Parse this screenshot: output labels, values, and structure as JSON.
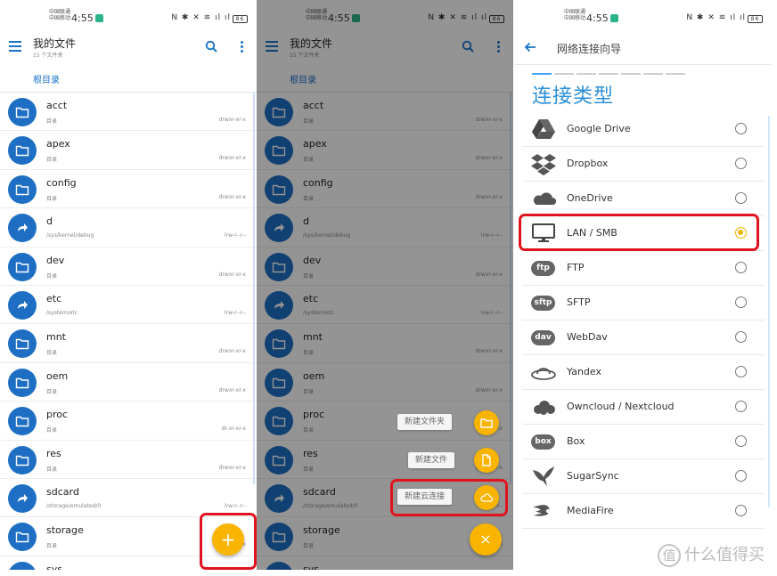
{
  "status_bar": {
    "carrier_1": "中国联通",
    "carrier_2": "中国移动",
    "time": "4:55",
    "icons": "N ✱ ✕ ≋ ıl ıl",
    "battery": "86"
  },
  "file_browser": {
    "title": "我的文件",
    "subtitle": "15 个文件夹",
    "breadcrumb": "根目录",
    "files": [
      {
        "name": "acct",
        "sub": "目录",
        "perm": "drwxr-xr-x",
        "type": "folder"
      },
      {
        "name": "apex",
        "sub": "目录",
        "perm": "drwxr-xr-x",
        "type": "folder"
      },
      {
        "name": "config",
        "sub": "目录",
        "perm": "drwxr-xr-x",
        "type": "folder"
      },
      {
        "name": "d",
        "sub": "/sys/kernel/debug",
        "perm": "lrw-r--r--",
        "type": "link"
      },
      {
        "name": "dev",
        "sub": "目录",
        "perm": "drwxr-xr-x",
        "type": "folder"
      },
      {
        "name": "etc",
        "sub": "/system/etc",
        "perm": "lrw-r--r--",
        "type": "link"
      },
      {
        "name": "mnt",
        "sub": "目录",
        "perm": "drwxr-xr-x",
        "type": "folder"
      },
      {
        "name": "oem",
        "sub": "目录",
        "perm": "drwxr-xr-x",
        "type": "folder"
      },
      {
        "name": "proc",
        "sub": "目录",
        "perm": "dr-xr-xr-x",
        "type": "folder"
      },
      {
        "name": "res",
        "sub": "目录",
        "perm": "drwxr-xr-x",
        "type": "folder"
      },
      {
        "name": "sdcard",
        "sub": "/storage/emulated/0",
        "perm": "lrw-r--r--",
        "type": "link"
      },
      {
        "name": "storage",
        "sub": "目录",
        "perm": "drwxr-xr-x",
        "type": "folder"
      },
      {
        "name": "sys",
        "sub": "",
        "perm": "",
        "type": "folder"
      }
    ],
    "fab_label": "+"
  },
  "fab_menu": {
    "new_folder": "新建文件夹",
    "new_file": "新建文件",
    "new_cloud": "新建云连接",
    "close_label": "×"
  },
  "wizard": {
    "title": "网络连接向导",
    "section_title": "连接类型",
    "selected": "LAN / SMB",
    "options": [
      {
        "label": "Google Drive",
        "icon": "google-drive-icon"
      },
      {
        "label": "Dropbox",
        "icon": "dropbox-icon"
      },
      {
        "label": "OneDrive",
        "icon": "onedrive-icon"
      },
      {
        "label": "LAN / SMB",
        "icon": "monitor-icon"
      },
      {
        "label": "FTP",
        "icon": "ftp-cloud-icon",
        "badge": "ftp"
      },
      {
        "label": "SFTP",
        "icon": "sftp-cloud-icon",
        "badge": "sftp"
      },
      {
        "label": "WebDav",
        "icon": "webdav-cloud-icon",
        "badge": "dav"
      },
      {
        "label": "Yandex",
        "icon": "yandex-ufo-icon"
      },
      {
        "label": "Owncloud / Nextcloud",
        "icon": "owncloud-icon"
      },
      {
        "label": "Box",
        "icon": "box-icon",
        "badge": "box"
      },
      {
        "label": "SugarSync",
        "icon": "sugarsync-bird-icon"
      },
      {
        "label": "MediaFire",
        "icon": "mediafire-icon"
      }
    ]
  },
  "watermark": {
    "logo": "值",
    "text": "什么值得买"
  },
  "colors": {
    "accent_blue": "#1a73c8",
    "folder_circle": "#1e6fc4",
    "fab_yellow": "#f9b400",
    "highlight_red": "#e0141e",
    "section_title_blue": "#2a8fd8"
  }
}
